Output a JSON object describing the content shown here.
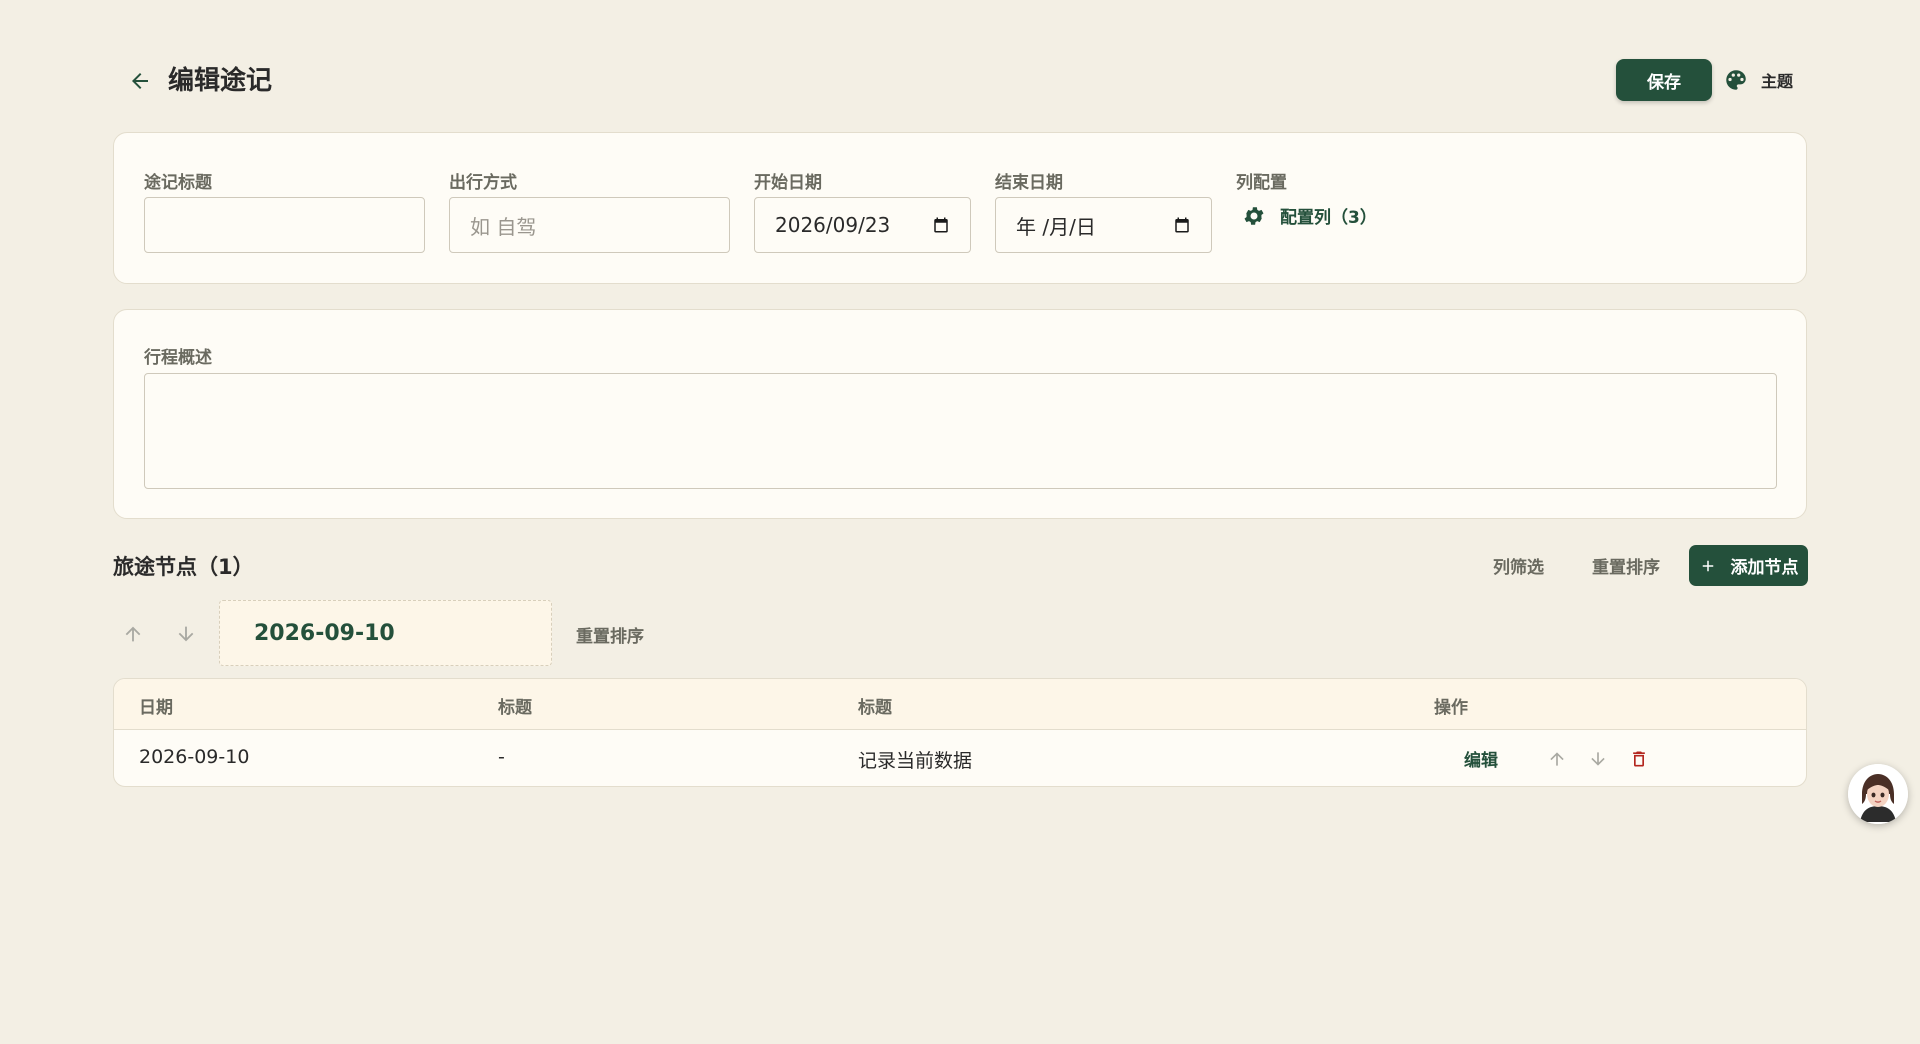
{
  "header": {
    "title": "编辑途记",
    "save_label": "保存",
    "theme_label": "主题"
  },
  "form": {
    "title_label": "途记标题",
    "title_value": "",
    "transport_label": "出行方式",
    "transport_placeholder": "如 自驾",
    "start_label": "开始日期",
    "start_value": "2026/09/23",
    "end_label": "结束日期",
    "end_placeholder": "年 /月/日",
    "columns_label": "列配置",
    "columns_button": "配置列（3）"
  },
  "summary": {
    "label": "行程概述",
    "value": ""
  },
  "nodes": {
    "title": "旅途节点（1）",
    "filter_label": "列筛选",
    "reset_sort_label": "重置排序",
    "add_label": "添加节点",
    "selected_date": "2026-09-10",
    "group_reset_label": "重置排序"
  },
  "table": {
    "headers": [
      "日期",
      "标题",
      "标题",
      "操作"
    ],
    "rows": [
      {
        "date": "2026-09-10",
        "col2": "-",
        "col3": "记录当前数据",
        "edit_label": "编辑"
      }
    ]
  },
  "colors": {
    "background": "#f3efe4",
    "primary": "#24503b",
    "card": "#fefcf6",
    "danger": "#b3261e"
  }
}
